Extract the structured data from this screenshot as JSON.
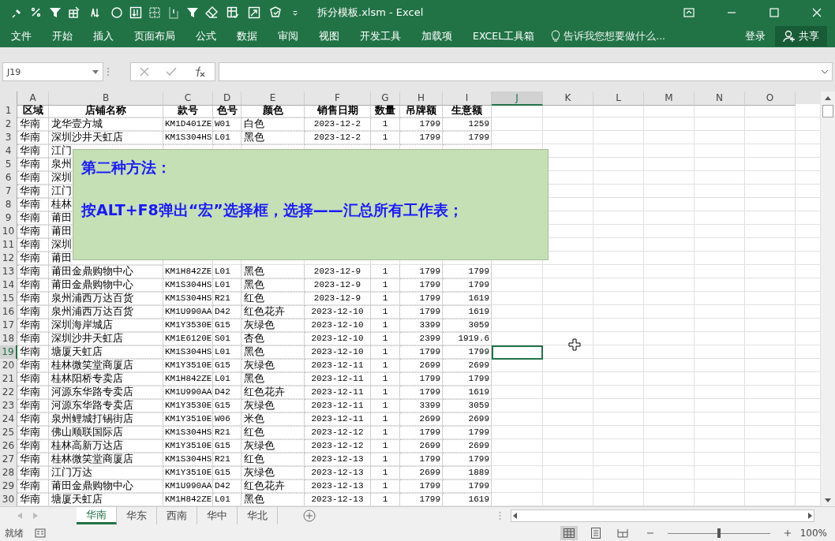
{
  "window": {
    "title": "拆分模板.xlsm - Excel"
  },
  "ribbon_tabs": [
    {
      "label": "文件"
    },
    {
      "label": "开始"
    },
    {
      "label": "插入"
    },
    {
      "label": "页面布局"
    },
    {
      "label": "公式"
    },
    {
      "label": "数据"
    },
    {
      "label": "审阅"
    },
    {
      "label": "视图"
    },
    {
      "label": "开发工具"
    },
    {
      "label": "加载项"
    },
    {
      "label": "EXCEL工具箱"
    }
  ],
  "tell_me": {
    "placeholder": "告诉我您想要做什么..."
  },
  "sign_in": "登录",
  "share": "共享",
  "name_box": "J19",
  "columns": [
    {
      "label": "A",
      "selected": false
    },
    {
      "label": "B",
      "selected": false
    },
    {
      "label": "C",
      "selected": false
    },
    {
      "label": "D",
      "selected": false
    },
    {
      "label": "E",
      "selected": false
    },
    {
      "label": "F",
      "selected": false
    },
    {
      "label": "G",
      "selected": false
    },
    {
      "label": "H",
      "selected": false
    },
    {
      "label": "I",
      "selected": false
    },
    {
      "label": "J",
      "selected": true
    },
    {
      "label": "K",
      "selected": false
    },
    {
      "label": "L",
      "selected": false
    },
    {
      "label": "M",
      "selected": false
    },
    {
      "label": "N",
      "selected": false
    },
    {
      "label": "O",
      "selected": false
    }
  ],
  "rows": [
    {
      "number": "1",
      "selected": false,
      "cells": [
        "区域",
        "店铺名称",
        "款号",
        "色号",
        "颜色",
        "销售日期",
        "数量",
        "吊牌额",
        "生意额"
      ]
    },
    {
      "number": "2",
      "selected": false,
      "cells": [
        "华南",
        "龙华壹方城",
        "KM1D401ZE",
        "W01",
        "白色",
        "2023-12-2",
        "1",
        "1799",
        "1259"
      ]
    },
    {
      "number": "3",
      "selected": false,
      "cells": [
        "华南",
        "深圳沙井天虹店",
        "KM1S304HS",
        "L01",
        "黑色",
        "2023-12-2",
        "1",
        "1799",
        "1799"
      ]
    },
    {
      "number": "4",
      "selected": false,
      "cells": [
        "华南",
        "江门"
      ]
    },
    {
      "number": "5",
      "selected": false,
      "cells": [
        "华南",
        "泉州"
      ]
    },
    {
      "number": "6",
      "selected": false,
      "cells": [
        "华南",
        "深圳"
      ]
    },
    {
      "number": "7",
      "selected": false,
      "cells": [
        "华南",
        "江门"
      ]
    },
    {
      "number": "8",
      "selected": false,
      "cells": [
        "华南",
        "桂林"
      ]
    },
    {
      "number": "9",
      "selected": false,
      "cells": [
        "华南",
        "莆田"
      ]
    },
    {
      "number": "10",
      "selected": false,
      "cells": [
        "华南",
        "莆田"
      ]
    },
    {
      "number": "11",
      "selected": false,
      "cells": [
        "华南",
        "深圳"
      ]
    },
    {
      "number": "12",
      "selected": false,
      "cells": [
        "华南",
        "莆田"
      ]
    },
    {
      "number": "13",
      "selected": false,
      "cells": [
        "华南",
        "莆田金鼎购物中心",
        "KM1H842ZE",
        "L01",
        "黑色",
        "2023-12-9",
        "1",
        "1799",
        "1799"
      ]
    },
    {
      "number": "14",
      "selected": false,
      "cells": [
        "华南",
        "莆田金鼎购物中心",
        "KM1S304HS",
        "L01",
        "黑色",
        "2023-12-9",
        "1",
        "1799",
        "1799"
      ]
    },
    {
      "number": "15",
      "selected": false,
      "cells": [
        "华南",
        "泉州浦西万达百货",
        "KM1S304HS",
        "R21",
        "红色",
        "2023-12-9",
        "1",
        "1799",
        "1619"
      ]
    },
    {
      "number": "16",
      "selected": false,
      "cells": [
        "华南",
        "泉州浦西万达百货",
        "KM1U990AA",
        "D42",
        "红色花卉",
        "2023-12-10",
        "1",
        "1799",
        "1619"
      ]
    },
    {
      "number": "17",
      "selected": false,
      "cells": [
        "华南",
        "深圳海岸城店",
        "KM1Y3530E",
        "G15",
        "灰绿色",
        "2023-12-10",
        "1",
        "3399",
        "3059"
      ]
    },
    {
      "number": "18",
      "selected": false,
      "cells": [
        "华南",
        "深圳沙井天虹店",
        "KM1E6120E",
        "S01",
        "杏色",
        "2023-12-10",
        "1",
        "2399",
        "1919.6"
      ]
    },
    {
      "number": "19",
      "selected": true,
      "cells": [
        "华南",
        "塘厦天虹店",
        "KM1S304HS",
        "L01",
        "黑色",
        "2023-12-10",
        "1",
        "1799",
        "1799"
      ]
    },
    {
      "number": "20",
      "selected": false,
      "cells": [
        "华南",
        "桂林微笑堂商厦店",
        "KM1Y3510E",
        "G15",
        "灰绿色",
        "2023-12-11",
        "1",
        "2699",
        "2699"
      ]
    },
    {
      "number": "21",
      "selected": false,
      "cells": [
        "华南",
        "桂林阳桥专卖店",
        "KM1H842ZE",
        "L01",
        "黑色",
        "2023-12-11",
        "1",
        "1799",
        "1799"
      ]
    },
    {
      "number": "22",
      "selected": false,
      "cells": [
        "华南",
        "河源东华路专卖店",
        "KM1U990AA",
        "D42",
        "红色花卉",
        "2023-12-11",
        "1",
        "1799",
        "1619"
      ]
    },
    {
      "number": "23",
      "selected": false,
      "cells": [
        "华南",
        "河源东华路专卖店",
        "KM1Y3530E",
        "G15",
        "灰绿色",
        "2023-12-11",
        "1",
        "3399",
        "3059"
      ]
    },
    {
      "number": "24",
      "selected": false,
      "cells": [
        "华南",
        "泉州鲤城打锡街店",
        "KM1Y3510E",
        "W06",
        "米色",
        "2023-12-11",
        "1",
        "2699",
        "2699"
      ]
    },
    {
      "number": "25",
      "selected": false,
      "cells": [
        "华南",
        "佛山顺联国际店",
        "KM1S304HS",
        "R21",
        "红色",
        "2023-12-12",
        "1",
        "1799",
        "1799"
      ]
    },
    {
      "number": "26",
      "selected": false,
      "cells": [
        "华南",
        "桂林高新万达店",
        "KM1Y3510E",
        "G15",
        "灰绿色",
        "2023-12-12",
        "1",
        "2699",
        "2699"
      ]
    },
    {
      "number": "27",
      "selected": false,
      "cells": [
        "华南",
        "桂林微笑堂商厦店",
        "KM1S304HS",
        "R21",
        "红色",
        "2023-12-13",
        "1",
        "1799",
        "1799"
      ]
    },
    {
      "number": "28",
      "selected": false,
      "cells": [
        "华南",
        "江门万达",
        "KM1Y3510E",
        "G15",
        "灰绿色",
        "2023-12-13",
        "1",
        "2699",
        "1889"
      ]
    },
    {
      "number": "29",
      "selected": false,
      "cells": [
        "华南",
        "莆田金鼎购物中心",
        "KM1U990AA",
        "D42",
        "红色花卉",
        "2023-12-13",
        "1",
        "1799",
        "1799"
      ]
    },
    {
      "number": "30",
      "selected": false,
      "cells": [
        "华南",
        "塘厦天虹店",
        "KM1H842ZE",
        "L01",
        "黑色",
        "2023-12-13",
        "1",
        "1799",
        "1619"
      ]
    }
  ],
  "callout": {
    "title": "第二种方法：",
    "body": "按ALT+F8弹出“宏”选择框，选择——汇总所有工作表；"
  },
  "sheet_tabs": [
    {
      "label": "华南",
      "selected": true
    },
    {
      "label": "华东",
      "selected": false
    },
    {
      "label": "西南",
      "selected": false
    },
    {
      "label": "华中",
      "selected": false
    },
    {
      "label": "华北",
      "selected": false
    }
  ],
  "status_bar": {
    "status": "就绪",
    "zoom": "100%",
    "level": 0.5
  }
}
